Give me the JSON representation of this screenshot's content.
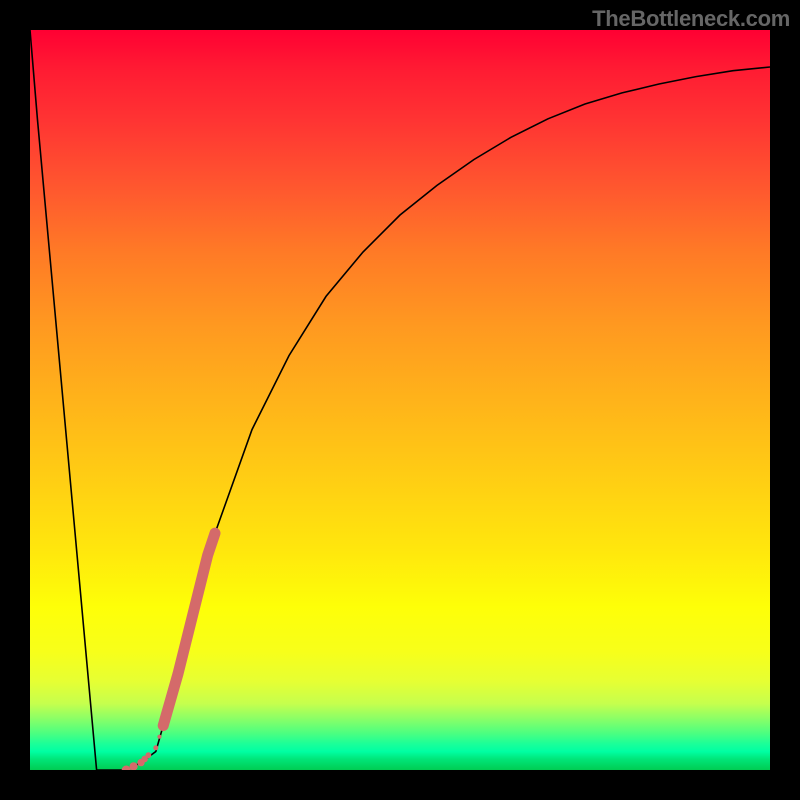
{
  "watermark": "TheBottleneck.com",
  "colors": {
    "frame": "#000000",
    "curve": "#000000",
    "marker": "#d46a6a"
  },
  "chart_data": {
    "type": "line",
    "title": "",
    "xlabel": "",
    "ylabel": "",
    "xlim": [
      0,
      100
    ],
    "ylim": [
      0,
      100
    ],
    "grid": false,
    "series": [
      {
        "name": "bottleneck-curve",
        "x": [
          0,
          1,
          2,
          3,
          4,
          5,
          6,
          7,
          8,
          9,
          10,
          11,
          12,
          13,
          14,
          15,
          17,
          20,
          25,
          30,
          35,
          40,
          45,
          50,
          55,
          60,
          65,
          70,
          75,
          80,
          85,
          90,
          95,
          100
        ],
        "values": [
          100,
          88,
          77,
          66,
          55,
          44,
          33,
          22,
          11,
          0,
          0,
          0,
          0,
          0,
          0.5,
          1,
          2.5,
          13,
          32,
          46,
          56,
          64,
          70,
          75,
          79,
          82.5,
          85.5,
          88,
          90,
          91.5,
          92.7,
          93.7,
          94.5,
          95
        ]
      }
    ],
    "markers": {
      "name": "highlight-segment",
      "color": "#d46a6a",
      "points": [
        {
          "x": 13,
          "y": 0
        },
        {
          "x": 14,
          "y": 0.5
        },
        {
          "x": 15,
          "y": 1
        },
        {
          "x": 15.5,
          "y": 1.5
        },
        {
          "x": 16,
          "y": 2
        },
        {
          "x": 17,
          "y": 3
        },
        {
          "x": 17.5,
          "y": 4.5
        },
        {
          "x": 18,
          "y": 6
        },
        {
          "x": 19,
          "y": 9.5
        },
        {
          "x": 20,
          "y": 13
        },
        {
          "x": 21,
          "y": 17
        },
        {
          "x": 22,
          "y": 21
        },
        {
          "x": 23,
          "y": 25
        },
        {
          "x": 24,
          "y": 29
        },
        {
          "x": 25,
          "y": 32
        }
      ]
    }
  }
}
